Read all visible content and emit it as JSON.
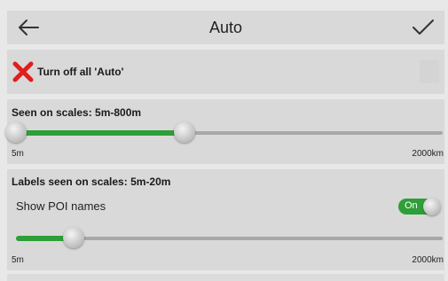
{
  "header": {
    "title": "Auto",
    "back_icon": "arrow-left-icon",
    "confirm_icon": "checkmark-icon"
  },
  "turn_off": {
    "label": "Turn off all 'Auto'",
    "icon": "red-x-icon",
    "icon_color": "#e01e1e"
  },
  "scales_section": {
    "title": "Seen on scales: 5m-800m",
    "range_min": "5m",
    "range_max": "2000km",
    "slider_low": 0.0,
    "slider_high": 0.395
  },
  "labels_section": {
    "title": "Labels seen on scales: 5m-20m",
    "poi_label": "Show POI names",
    "poi_toggle": "On",
    "range_min": "5m",
    "range_max": "2000km",
    "slider_value": 0.135
  },
  "colors": {
    "accent": "#2e9e38",
    "panel": "#d9d9d9",
    "background": "#e8e8e8"
  }
}
